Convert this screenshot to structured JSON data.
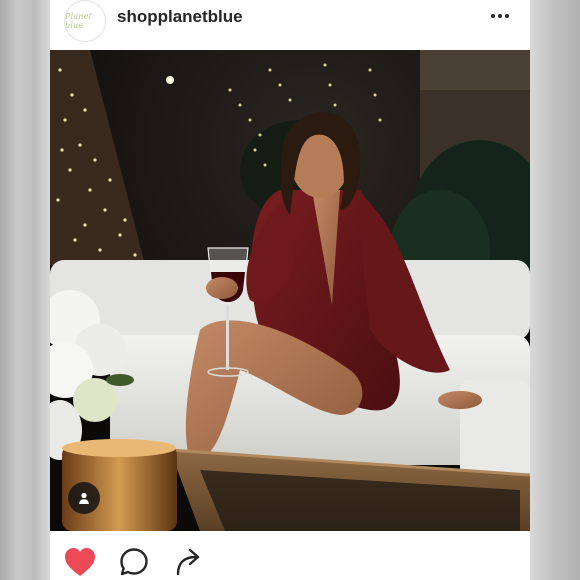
{
  "post": {
    "username": "shopplanetblue",
    "avatar_text": "Planet blue",
    "more_icon": "more-horizontal-icon",
    "tag_icon": "person-tag-icon"
  },
  "actions": {
    "like_icon": "heart-filled-icon",
    "comment_icon": "comment-bubble-icon",
    "share_icon": "share-arrow-icon",
    "like_color": "#ed4956"
  }
}
